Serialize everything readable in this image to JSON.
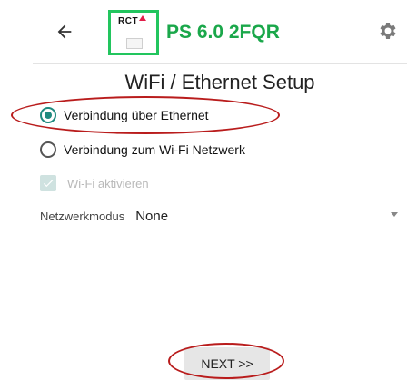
{
  "header": {
    "back_icon": "arrow-left-icon",
    "logo_text": "RCT",
    "app_title": "PS 6.0 2FQR",
    "settings_icon": "gear-icon",
    "logo_border_color": "#22c55e",
    "title_color": "#1aa74a"
  },
  "page": {
    "title": "WiFi / Ethernet Setup"
  },
  "connection_options": [
    {
      "label": "Verbindung über Ethernet",
      "selected": true
    },
    {
      "label": "Verbindung zum Wi-Fi Netzwerk",
      "selected": false
    }
  ],
  "wifi_checkbox": {
    "label": "Wi-Fi aktivieren",
    "checked": true,
    "disabled": true
  },
  "network_mode": {
    "label": "Netzwerkmodus",
    "value": "None"
  },
  "footer": {
    "next_label": "NEXT >>"
  },
  "colors": {
    "accent": "#1f8a7f",
    "annotation": "#b91c1c"
  }
}
